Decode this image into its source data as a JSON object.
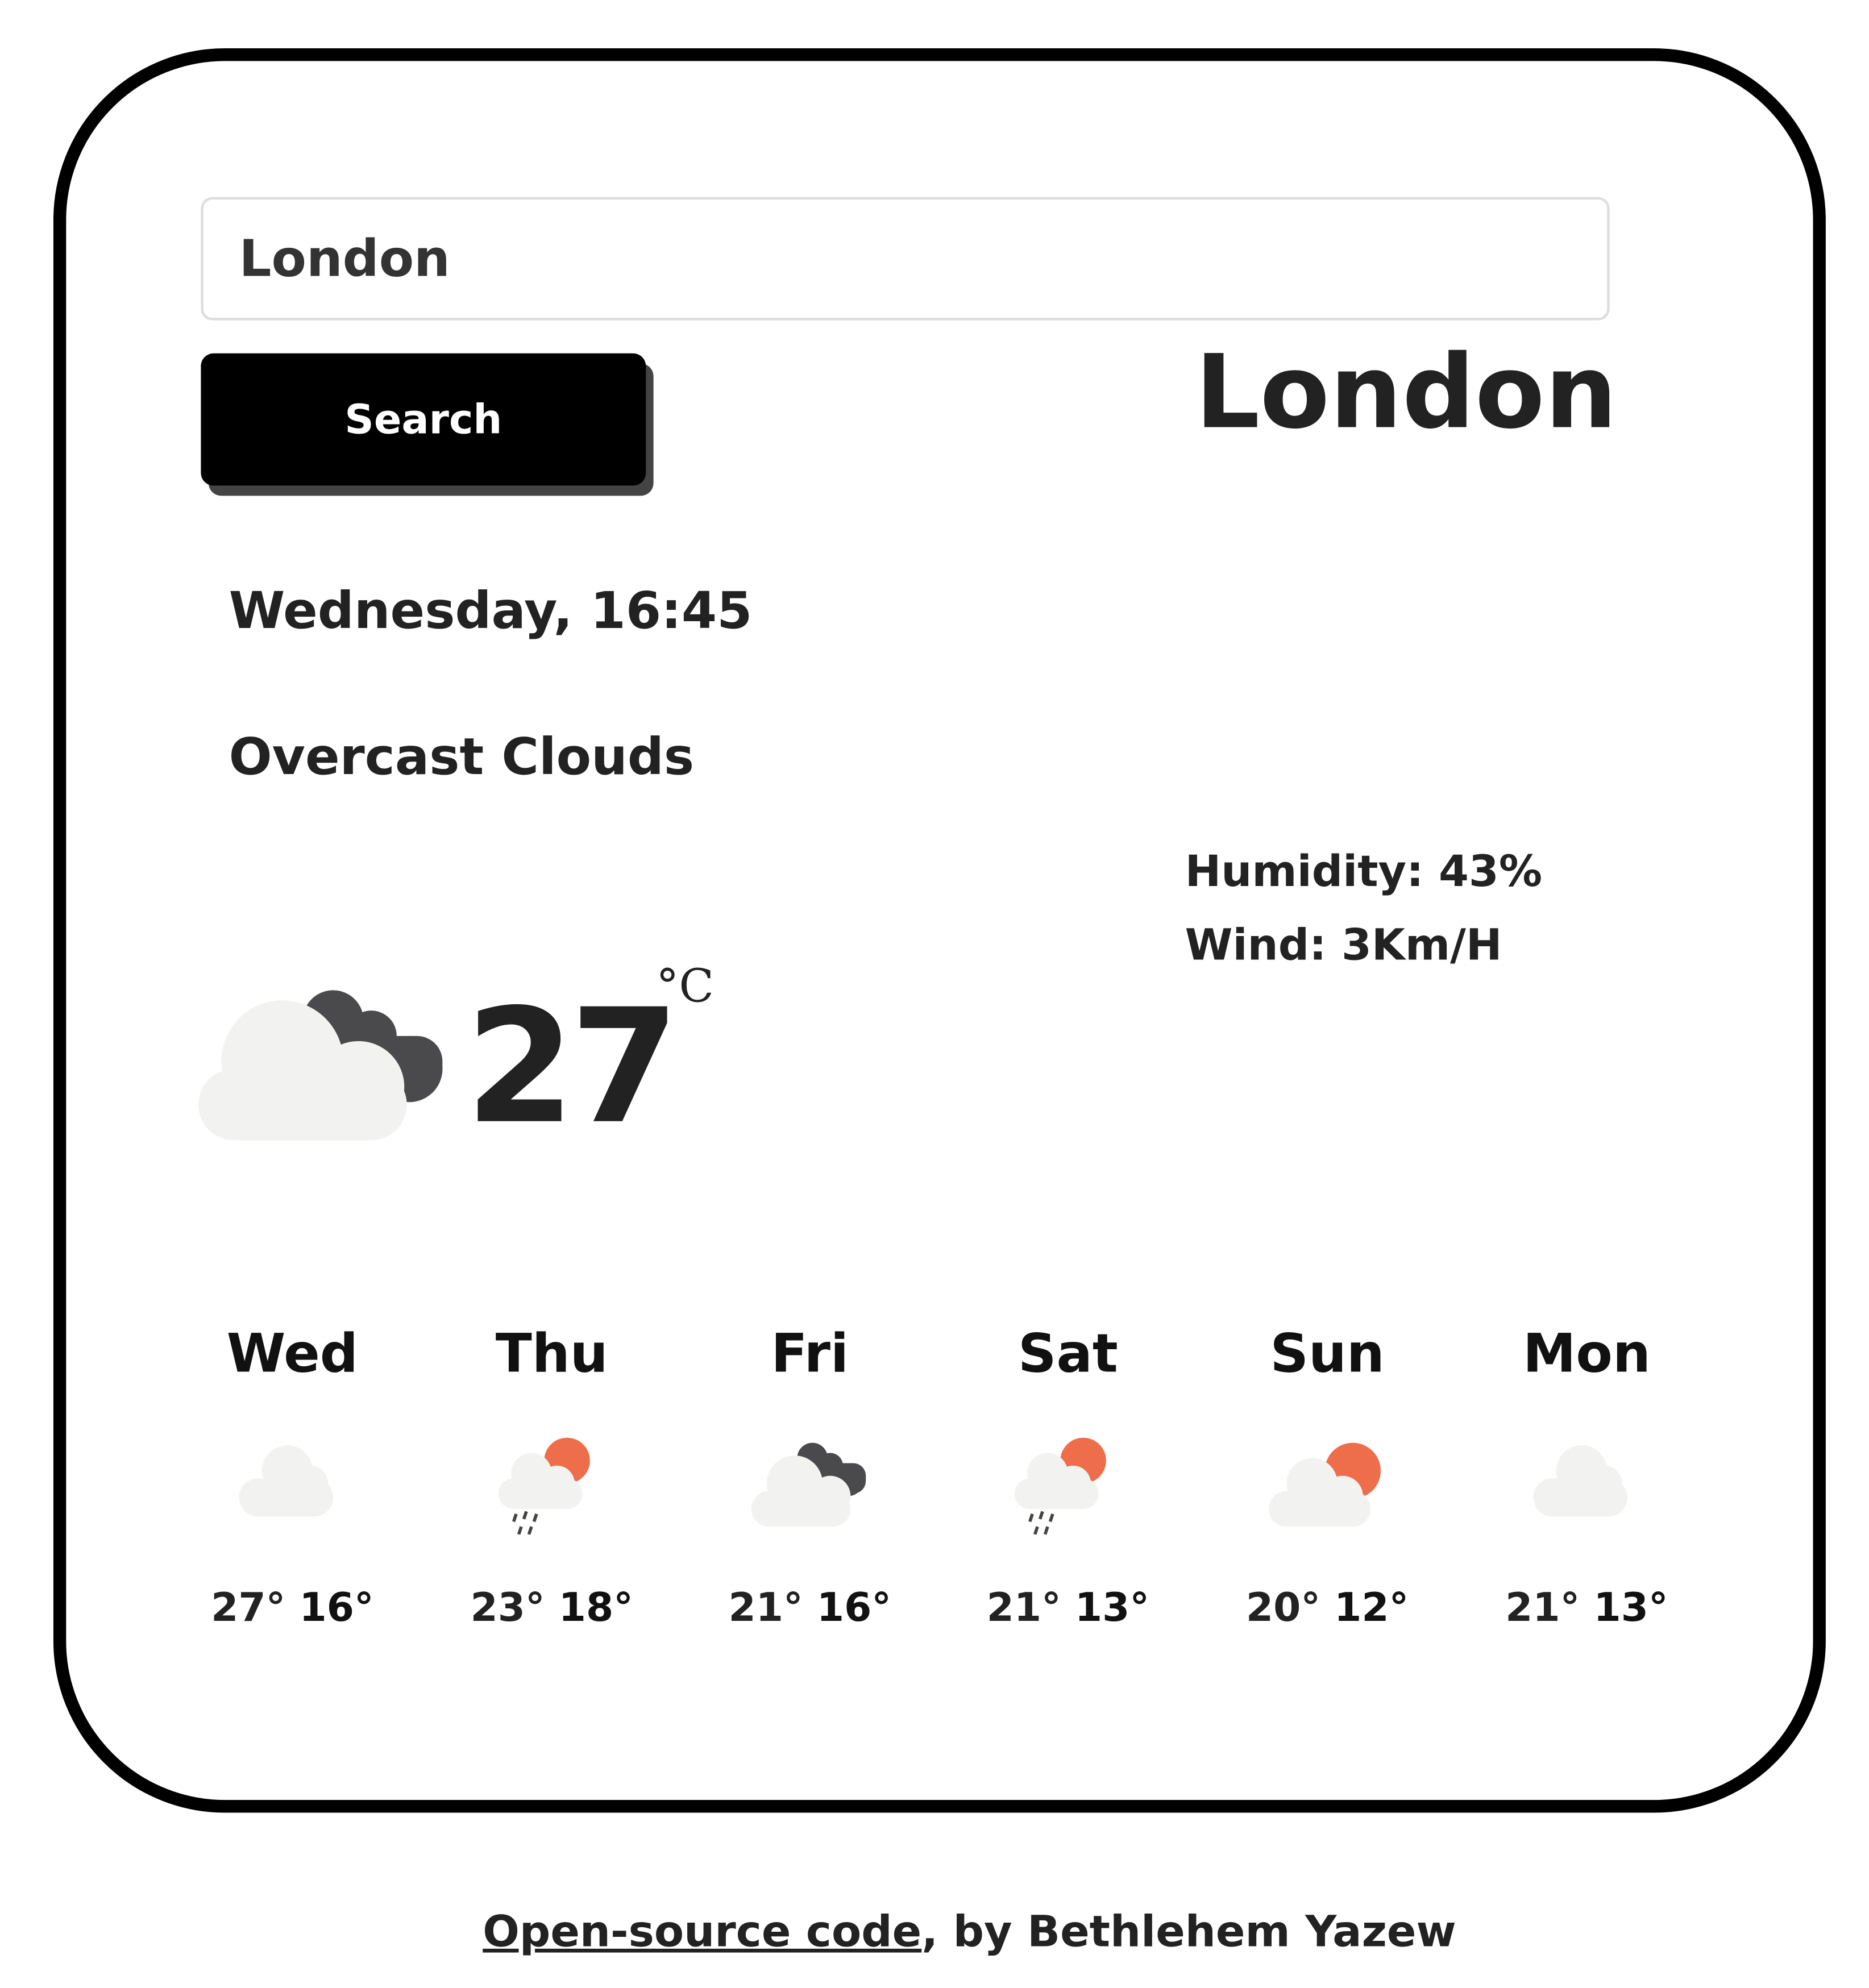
{
  "search": {
    "value": "London",
    "button_label": "Search"
  },
  "current": {
    "city": "London",
    "datetime": "Wednesday, 16:45",
    "description": "Overcast Clouds",
    "humidity_label": "Humidity: 43%",
    "wind_label": "Wind: 3Km/H",
    "temperature": "27",
    "unit": "°C",
    "icon": "broken-clouds-icon"
  },
  "forecast": [
    {
      "day": "Wed",
      "max": "27°",
      "min": "16°",
      "icon": "cloud"
    },
    {
      "day": "Thu",
      "max": "23°",
      "min": "18°",
      "icon": "rain-sun"
    },
    {
      "day": "Fri",
      "max": "21°",
      "min": "16°",
      "icon": "dark-cloud"
    },
    {
      "day": "Sat",
      "max": "21°",
      "min": "13°",
      "icon": "rain-sun"
    },
    {
      "day": "Sun",
      "max": "20°",
      "min": "12°",
      "icon": "sun-cloud"
    },
    {
      "day": "Mon",
      "max": "21°",
      "min": "13°",
      "icon": "cloud"
    }
  ],
  "footer": {
    "link_text": "Open-source code",
    "rest": ", by Bethlehem Yazew"
  },
  "colors": {
    "sun": "#ee6e4c",
    "dark_cloud": "#4a4a4c",
    "light_cloud": "#f2f2f1"
  }
}
